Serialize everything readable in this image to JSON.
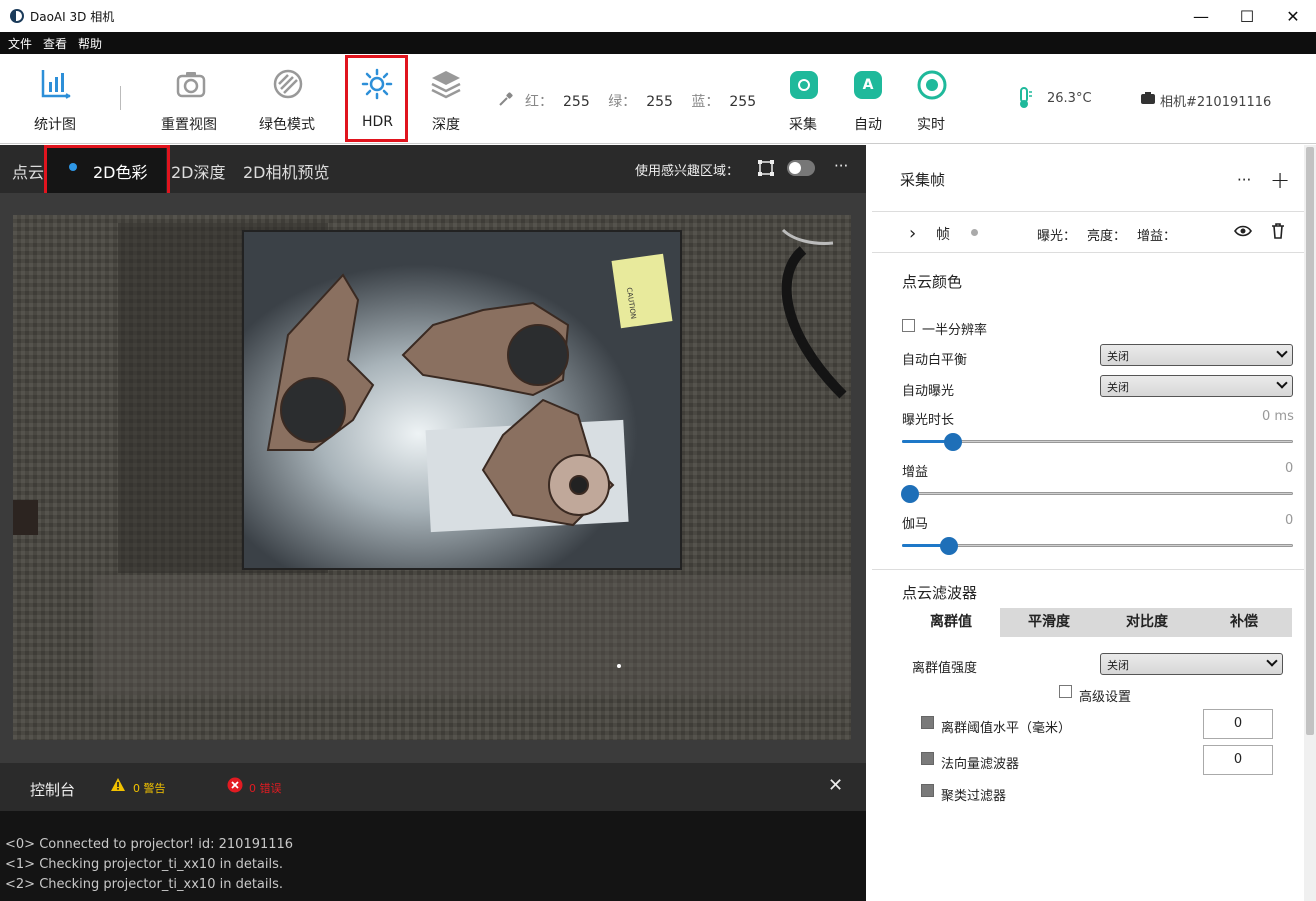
{
  "window": {
    "title": "DaoAI 3D 相机",
    "minimize": "—",
    "maximize": "☐",
    "close": "✕"
  },
  "menu": [
    "文件",
    "查看",
    "帮助"
  ],
  "toolbar": {
    "stats": "统计图",
    "reset_view": "重置视图",
    "green_mode": "绿色模式",
    "hdr": "HDR",
    "depth": "深度",
    "rgb": {
      "r_label": "红：",
      "r": "255",
      "g_label": "绿：",
      "g": "255",
      "b_label": "蓝：",
      "b": "255"
    },
    "capture": "采集",
    "auto": "自动",
    "auto_icon_letter": "A",
    "realtime": "实时",
    "temperature": "26.3°C",
    "camera": "相机#210191116"
  },
  "viewer": {
    "tabs": [
      "点云",
      "2D色彩",
      "2D深度",
      "2D相机预览"
    ],
    "active_tab": "2D色彩",
    "roi_label": "使用感兴趣区域：",
    "more": "···",
    "photo_label_text": "CAUTION"
  },
  "console": {
    "title": "控制台",
    "warnings": "0 警告",
    "errors": "0 错误",
    "close": "✕",
    "logs": [
      "<0> Connected to projector! id: 210191116",
      "<1> Checking projector_ti_xx10 in details.",
      "<2> Checking projector_ti_xx10 in details."
    ]
  },
  "panel": {
    "frames": {
      "title": "采集帧",
      "more": "···",
      "add": "+",
      "row": {
        "expand": "›",
        "label": "帧",
        "exposure": "曝光：",
        "brightness": "亮度：",
        "gain": "增益："
      }
    },
    "color": {
      "title": "点云颜色",
      "half_res": "一半分辨率",
      "awb_label": "自动白平衡",
      "awb_value": "关闭",
      "ae_label": "自动曝光",
      "ae_value": "关闭",
      "exposure_label": "曝光时长",
      "exposure_value": "0 ms",
      "exposure_level": 0.13,
      "gain_label": "增益",
      "gain_value": "0",
      "gain_level": 0.02,
      "gamma_label": "伽马",
      "gamma_value": "0",
      "gamma_level": 0.12
    },
    "filter": {
      "title": "点云滤波器",
      "tabs": [
        "离群值",
        "平滑度",
        "对比度",
        "补偿"
      ],
      "active_tab": "离群值",
      "strength_label": "离群值强度",
      "strength_value": "关闭",
      "advanced": "高级设置",
      "threshold_label": "离群阈值水平（毫米）",
      "threshold_value": "0",
      "normal_label": "法向量滤波器",
      "normal_value": "0",
      "cluster_label": "聚类过滤器"
    }
  },
  "colors": {
    "accent": "#1e78c8",
    "green": "#1fb99b",
    "highlight": "#e0141e",
    "warning": "#f2c200",
    "error": "#e21b22"
  }
}
